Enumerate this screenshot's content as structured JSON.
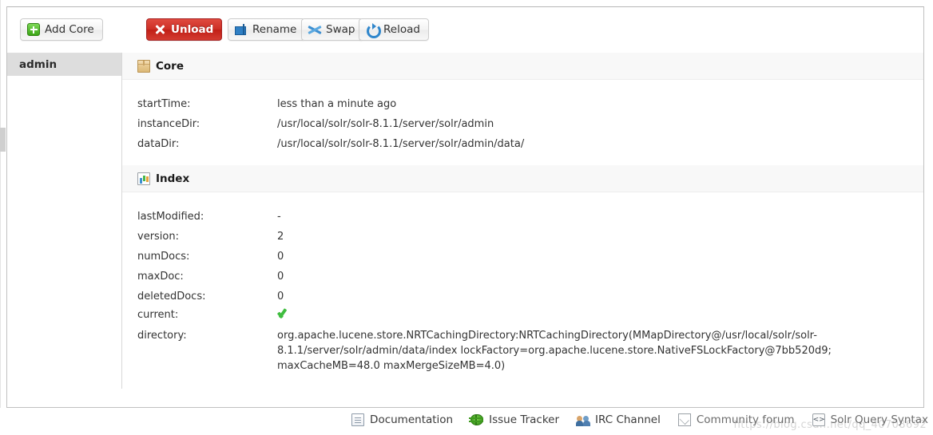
{
  "toolbar": {
    "add_core": {
      "label": "Add Core",
      "icon": "plus-icon"
    },
    "unload": {
      "label": "Unload",
      "icon": "red-x-icon"
    },
    "rename": {
      "label": "Rename",
      "icon": "rename-textbox-icon"
    },
    "swap": {
      "label": "Swap",
      "icon": "swap-arrows-icon"
    },
    "reload": {
      "label": "Reload",
      "icon": "reload-circular-arrow-icon"
    }
  },
  "sidebar": {
    "cores": [
      {
        "name": "admin",
        "selected": true
      }
    ]
  },
  "sections": {
    "core": {
      "title": "Core",
      "icon": "box-icon",
      "rows": [
        {
          "key": "startTime:",
          "value": "less than a minute ago"
        },
        {
          "key": "instanceDir:",
          "value": "/usr/local/solr/solr-8.1.1/server/solr/admin"
        },
        {
          "key": "dataDir:",
          "value": "/usr/local/solr/solr-8.1.1/server/solr/admin/data/"
        }
      ]
    },
    "index": {
      "title": "Index",
      "icon": "bar-chart-icon",
      "rows": [
        {
          "key": "lastModified:",
          "value": "-"
        },
        {
          "key": "version:",
          "value": "2"
        },
        {
          "key": "numDocs:",
          "value": "0"
        },
        {
          "key": "maxDoc:",
          "value": "0"
        },
        {
          "key": "deletedDocs:",
          "value": "0"
        },
        {
          "key": "current:",
          "value": "",
          "icon": "green-check-icon"
        },
        {
          "key": "directory:",
          "value": "org.apache.lucene.store.NRTCachingDirectory:NRTCachingDirectory(MMapDirectory@/usr/local/solr/solr-8.1.1/server/solr/admin/data/index lockFactory=org.apache.lucene.store.NativeFSLockFactory@7bb520d9; maxCacheMB=48.0 maxMergeSizeMB=4.0)"
        }
      ]
    }
  },
  "footer": {
    "links": [
      {
        "label": "Documentation",
        "icon": "document-icon"
      },
      {
        "label": "Issue Tracker",
        "icon": "bug-icon"
      },
      {
        "label": "IRC Channel",
        "icon": "people-icon"
      },
      {
        "label": "Community forum",
        "icon": "envelope-icon"
      },
      {
        "label": "Solr Query Syntax",
        "icon": "code-icon"
      }
    ],
    "watermark": "https://blog.csdn.net/qq_40708692"
  },
  "colors": {
    "danger": "#c82e23",
    "accent_blue": "#2f86cc",
    "success_green": "#3fbd3f",
    "selected_bg": "#dddddd",
    "section_bg": "#f8f8f8"
  }
}
